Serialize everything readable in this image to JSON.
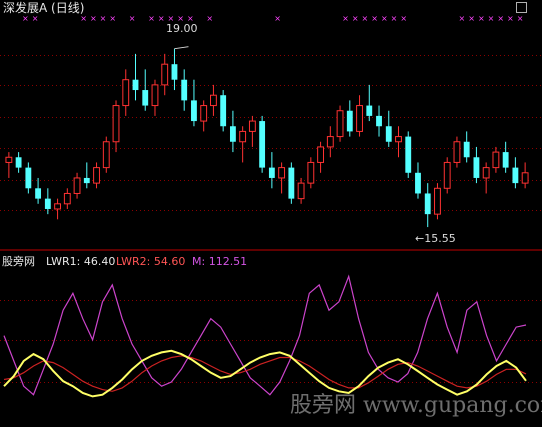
{
  "header": {
    "title": "深发展A (日线)"
  },
  "lower_panel": {
    "indicator_name": "股旁网",
    "lwr1_text": "LWR1: 46.40",
    "lwr2_text": "LWR2: 54.60",
    "m_text": "M: 112.51"
  },
  "annotations": {
    "high_label": "19.00",
    "low_label": "←15.55"
  },
  "watermark": "股旁网 www.gupang.com",
  "colors": {
    "background": "#000000",
    "up_candle": "#ff3232",
    "down_candle": "#54ffff",
    "lwr1": "#ffff66",
    "lwr2": "#cc2222",
    "m": "#cc44cc",
    "grid": "#8b0000",
    "signal_marks": "#ff44ff"
  },
  "chart_data": [
    {
      "type": "candlestick",
      "title": "深发展A (日线)",
      "ohlc": [
        [
          16.8,
          17.0,
          16.5,
          16.9
        ],
        [
          16.9,
          17.0,
          16.6,
          16.7
        ],
        [
          16.7,
          16.8,
          16.2,
          16.3
        ],
        [
          16.3,
          16.5,
          16.0,
          16.1
        ],
        [
          16.1,
          16.3,
          15.8,
          15.9
        ],
        [
          15.9,
          16.1,
          15.7,
          16.0
        ],
        [
          16.0,
          16.3,
          15.9,
          16.2
        ],
        [
          16.2,
          16.6,
          16.1,
          16.5
        ],
        [
          16.5,
          16.8,
          16.3,
          16.4
        ],
        [
          16.4,
          16.8,
          16.3,
          16.7
        ],
        [
          16.7,
          17.3,
          16.6,
          17.2
        ],
        [
          17.2,
          18.0,
          17.0,
          17.9
        ],
        [
          17.9,
          18.6,
          17.7,
          18.4
        ],
        [
          18.4,
          18.9,
          18.0,
          18.2
        ],
        [
          18.2,
          18.6,
          17.8,
          17.9
        ],
        [
          17.9,
          18.4,
          17.7,
          18.3
        ],
        [
          18.3,
          18.9,
          18.1,
          18.7
        ],
        [
          18.7,
          19.0,
          18.2,
          18.4
        ],
        [
          18.4,
          18.6,
          17.8,
          18.0
        ],
        [
          18.0,
          18.4,
          17.5,
          17.6
        ],
        [
          17.6,
          18.0,
          17.4,
          17.9
        ],
        [
          17.9,
          18.3,
          17.7,
          18.1
        ],
        [
          18.1,
          18.2,
          17.4,
          17.5
        ],
        [
          17.5,
          17.8,
          17.0,
          17.2
        ],
        [
          17.2,
          17.5,
          16.8,
          17.4
        ],
        [
          17.4,
          17.7,
          17.1,
          17.6
        ],
        [
          17.6,
          17.7,
          16.6,
          16.7
        ],
        [
          16.7,
          17.0,
          16.3,
          16.5
        ],
        [
          16.5,
          16.8,
          16.2,
          16.7
        ],
        [
          16.7,
          16.8,
          16.0,
          16.1
        ],
        [
          16.1,
          16.5,
          16.0,
          16.4
        ],
        [
          16.4,
          16.9,
          16.3,
          16.8
        ],
        [
          16.8,
          17.2,
          16.6,
          17.1
        ],
        [
          17.1,
          17.5,
          16.9,
          17.3
        ],
        [
          17.3,
          17.9,
          17.2,
          17.8
        ],
        [
          17.8,
          18.0,
          17.3,
          17.4
        ],
        [
          17.4,
          18.1,
          17.3,
          17.9
        ],
        [
          17.9,
          18.3,
          17.6,
          17.7
        ],
        [
          17.7,
          17.9,
          17.3,
          17.5
        ],
        [
          17.5,
          17.8,
          17.1,
          17.2
        ],
        [
          17.2,
          17.5,
          16.9,
          17.3
        ],
        [
          17.3,
          17.4,
          16.5,
          16.6
        ],
        [
          16.6,
          16.8,
          16.1,
          16.2
        ],
        [
          16.2,
          16.4,
          15.55,
          15.8
        ],
        [
          15.8,
          16.4,
          15.7,
          16.3
        ],
        [
          16.3,
          16.9,
          16.2,
          16.8
        ],
        [
          16.8,
          17.3,
          16.7,
          17.2
        ],
        [
          17.2,
          17.4,
          16.8,
          16.9
        ],
        [
          16.9,
          17.1,
          16.4,
          16.5
        ],
        [
          16.5,
          16.8,
          16.2,
          16.7
        ],
        [
          16.7,
          17.1,
          16.6,
          17.0
        ],
        [
          17.0,
          17.2,
          16.6,
          16.7
        ],
        [
          16.7,
          16.9,
          16.3,
          16.4
        ],
        [
          16.4,
          16.8,
          16.3,
          16.6
        ]
      ],
      "annotations": [
        "19.00",
        "←15.55"
      ]
    },
    {
      "type": "line",
      "series": [
        {
          "name": "LWR1",
          "values": [
            40,
            52,
            70,
            78,
            72,
            58,
            46,
            40,
            32,
            28,
            30,
            38,
            48,
            60,
            70,
            76,
            80,
            82,
            78,
            72,
            64,
            56,
            50,
            52,
            60,
            68,
            74,
            78,
            80,
            76,
            66,
            56,
            46,
            38,
            34,
            32,
            40,
            52,
            62,
            68,
            72,
            66,
            58,
            50,
            42,
            36,
            30,
            34,
            42,
            54,
            64,
            70,
            62,
            46.4
          ]
        },
        {
          "name": "LWR2",
          "values": [
            48,
            50,
            56,
            64,
            70,
            68,
            62,
            54,
            46,
            40,
            36,
            34,
            38,
            46,
            56,
            64,
            70,
            74,
            76,
            74,
            70,
            64,
            58,
            54,
            56,
            60,
            66,
            70,
            74,
            74,
            70,
            64,
            56,
            48,
            42,
            38,
            38,
            44,
            52,
            60,
            66,
            68,
            64,
            58,
            52,
            46,
            40,
            38,
            40,
            46,
            54,
            60,
            60,
            54.6
          ]
        },
        {
          "name": "M",
          "values": [
            100,
            70,
            40,
            30,
            60,
            90,
            130,
            150,
            120,
            95,
            140,
            160,
            120,
            90,
            70,
            50,
            40,
            45,
            60,
            80,
            100,
            120,
            110,
            90,
            70,
            50,
            40,
            30,
            45,
            70,
            100,
            150,
            160,
            130,
            140,
            170,
            120,
            80,
            60,
            50,
            45,
            55,
            80,
            120,
            150,
            110,
            80,
            130,
            140,
            100,
            70,
            90,
            110,
            112.51
          ]
        }
      ]
    }
  ]
}
